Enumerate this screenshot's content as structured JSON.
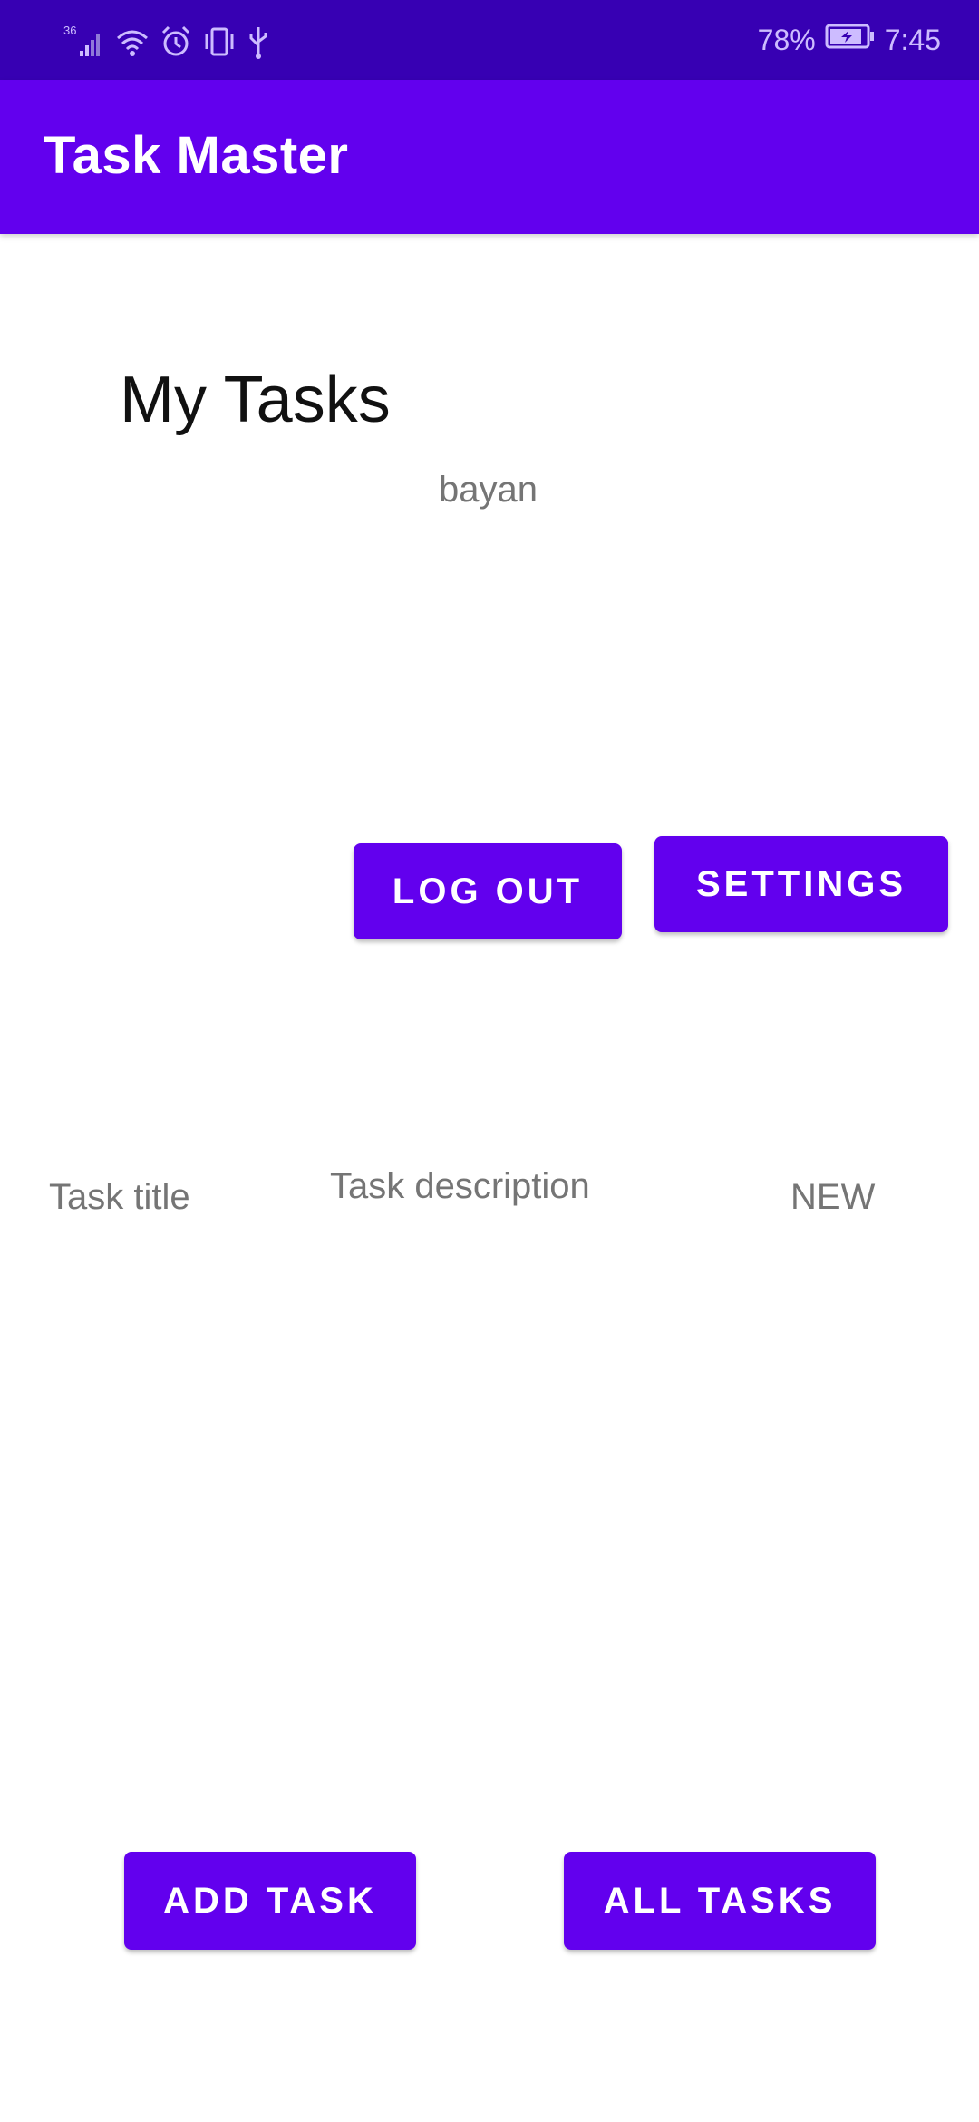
{
  "status_bar": {
    "network_label": "36",
    "battery_percent": "78%",
    "time": "7:45",
    "icons": [
      "signal-icon",
      "wifi-icon",
      "alarm-icon",
      "vibrate-icon",
      "usb-icon",
      "battery-icon"
    ]
  },
  "app_bar": {
    "title": "Task Master"
  },
  "main": {
    "heading": "My Tasks",
    "username": "bayan",
    "logout_label": "LOG OUT",
    "settings_label": "SETTINGS",
    "task_item": {
      "title": "Task title",
      "description": "Task description",
      "state": "NEW"
    },
    "add_task_label": "ADD TASK",
    "all_tasks_label": "ALL TASKS"
  },
  "colors": {
    "status_bar": "#3700b3",
    "primary": "#6200ee",
    "secondary_text": "#757575",
    "heading_text": "#111111"
  }
}
